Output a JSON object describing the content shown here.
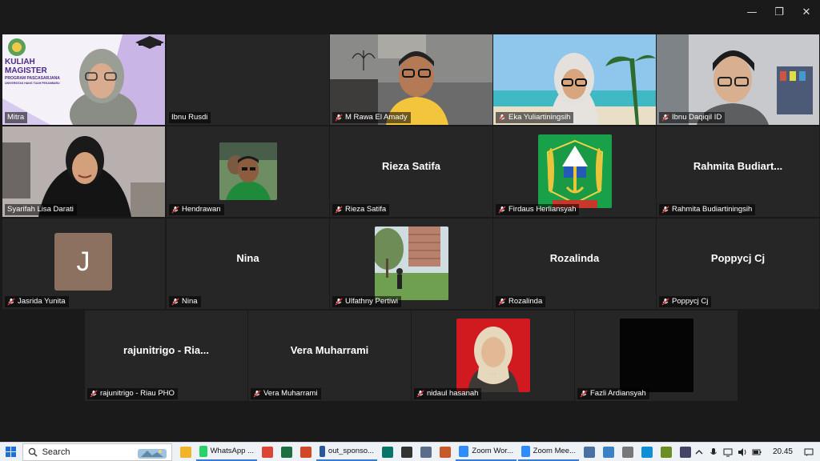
{
  "window": {
    "minimize": "—",
    "restore": "❐",
    "close": "✕"
  },
  "participants": [
    {
      "name": "Mitra",
      "muted": false,
      "kind": "video",
      "scene": "banner",
      "banner_line1": "KULIAH",
      "banner_line2": "MAGISTER",
      "banner_line3": "PROGRAM PASCASARJANA",
      "banner_line4": "UNIVERSITAS HANG TUAH PEKANBARU"
    },
    {
      "name": "Ibnu Rusdi",
      "muted": false,
      "kind": "empty"
    },
    {
      "name": "M Rawa El Amady",
      "muted": true,
      "kind": "video",
      "scene": "man-yellow"
    },
    {
      "name": "Eka Yuliartiningsih",
      "muted": true,
      "kind": "video",
      "scene": "woman-beach"
    },
    {
      "name": "Ibnu Daqiqil ID",
      "muted": true,
      "kind": "video",
      "scene": "man-glasses"
    },
    {
      "name": "Syarifah Lisa Darati",
      "muted": false,
      "kind": "video",
      "scene": "woman-dark",
      "active": true
    },
    {
      "name": "Hendrawan",
      "muted": true,
      "kind": "photo",
      "scene": "man-green"
    },
    {
      "name": "Rieza Satifa",
      "muted": true,
      "kind": "text",
      "display": "Rieza Satifa"
    },
    {
      "name": "Firdaus Herliansyah",
      "muted": true,
      "kind": "photo",
      "scene": "emblem"
    },
    {
      "name": "Rahmita Budiartiningsih",
      "muted": true,
      "kind": "text",
      "display": "Rahmita  Budiart..."
    },
    {
      "name": "Jasrida Yunita",
      "muted": true,
      "kind": "letter",
      "letter": "J"
    },
    {
      "name": "Nina",
      "muted": true,
      "kind": "text",
      "display": "Nina"
    },
    {
      "name": "Ulfathny Pertiwi",
      "muted": true,
      "kind": "photo",
      "scene": "park"
    },
    {
      "name": "Rozalinda",
      "muted": true,
      "kind": "text",
      "display": "Rozalinda"
    },
    {
      "name": "Poppycj Cj",
      "muted": true,
      "kind": "text",
      "display": "Poppycj Cj"
    },
    {
      "name": "rajunitrigo - Riau PHO",
      "muted": true,
      "kind": "text",
      "display": "rajunitrigo  -  Ria..."
    },
    {
      "name": "Vera Muharrami",
      "muted": true,
      "kind": "text",
      "display": "Vera Muharrami"
    },
    {
      "name": "nidaul hasanah",
      "muted": true,
      "kind": "photo",
      "scene": "portrait-red"
    },
    {
      "name": "Fazli Ardiansyah",
      "muted": true,
      "kind": "photo",
      "scene": "black"
    }
  ],
  "taskbar": {
    "search_label": "Search",
    "apps": [
      {
        "label": "",
        "icon": "file-explorer-icon",
        "color": "#f0b429"
      },
      {
        "label": "WhatsApp ...",
        "icon": "whatsapp-icon",
        "color": "#25d366",
        "wide": true
      },
      {
        "label": "",
        "icon": "chrome-icon",
        "color": "#db4437"
      },
      {
        "label": "",
        "icon": "excel-icon",
        "color": "#1d6f42"
      },
      {
        "label": "",
        "icon": "powerpoint-icon",
        "color": "#d24726"
      },
      {
        "label": "out_sponso...",
        "icon": "word-icon",
        "color": "#2b579a",
        "wide": true
      },
      {
        "label": "",
        "icon": "publisher-icon",
        "color": "#077568"
      },
      {
        "label": "",
        "icon": "terminal-icon",
        "color": "#333333"
      },
      {
        "label": "",
        "icon": "snip-icon",
        "color": "#5a6e8c"
      },
      {
        "label": "",
        "icon": "paint-icon",
        "color": "#c85a2a"
      },
      {
        "label": "Zoom Wor...",
        "icon": "zoom-icon",
        "color": "#2d8cff",
        "wide": true
      },
      {
        "label": "Zoom Mee...",
        "icon": "zoom-icon",
        "color": "#2d8cff",
        "wide": true
      },
      {
        "label": "",
        "icon": "app-icon",
        "color": "#4a6fa5"
      },
      {
        "label": "",
        "icon": "network-icon",
        "color": "#3b82c4"
      },
      {
        "label": "",
        "icon": "app-icon",
        "color": "#777777"
      },
      {
        "label": "",
        "icon": "edge-icon",
        "color": "#0f8fd6"
      },
      {
        "label": "",
        "icon": "app-icon",
        "color": "#6b8e23"
      },
      {
        "label": "",
        "icon": "app-icon",
        "color": "#444466"
      }
    ],
    "clock": "20.45"
  }
}
